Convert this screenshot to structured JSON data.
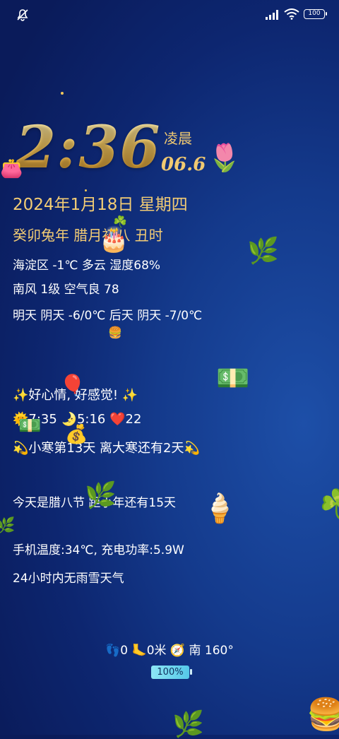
{
  "status_bar": {
    "battery": "100"
  },
  "clock": {
    "time": "2:36",
    "period": "凌晨",
    "date_short": "06.6"
  },
  "info": {
    "date": "2024年1月18日 星期四",
    "lunar": "癸卯兔年 腊月初八  丑时",
    "weather_line1": "海淀区 -1℃ 多云 湿度68%",
    "weather_line2": "南风 1级 空气良 78",
    "forecast": "明天 阴天 -6/0℃ 后天 阴天 -7/0℃",
    "mood": "✨好心情, 好感觉! ✨",
    "sun_moon": "🌞7:35 🌛5:16 ❤️22",
    "solar_term": "💫小寒第13天  离大寒还有2天💫",
    "festival": "今天是腊八节 距小年还有15天",
    "phone_status": "手机温度:34℃, 充电功率:5.9W",
    "rain": "24小时内无雨雪天气"
  },
  "footer": {
    "steps": "👣0 🦶0米 🧭 南 160°",
    "battery_badge": "100%"
  },
  "decorations": [
    "tulip-icon",
    "cake-icon",
    "leaf-icon",
    "clover-icon",
    "burger-icon",
    "money-icon",
    "balloon-icon",
    "money-bag-icon",
    "ice-cream-icon",
    "purse-icon"
  ]
}
